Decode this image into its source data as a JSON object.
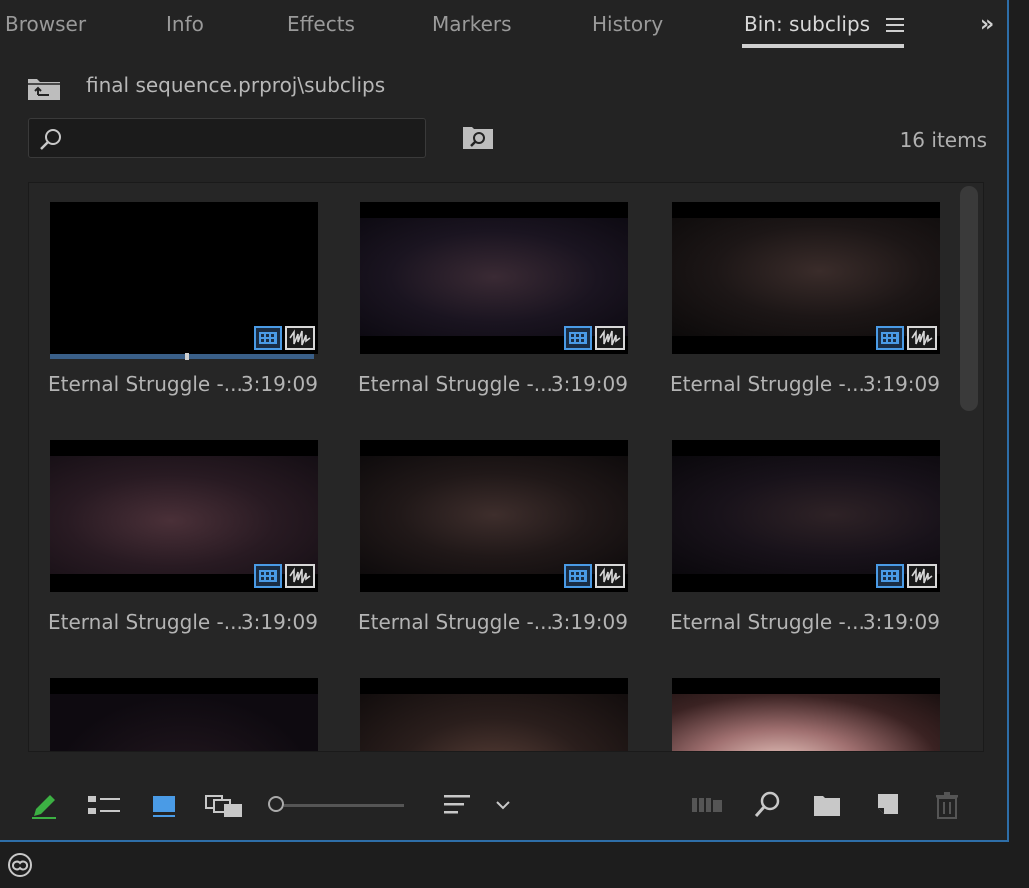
{
  "tabs": [
    {
      "label": "Browser"
    },
    {
      "label": "Info"
    },
    {
      "label": "Effects"
    },
    {
      "label": "Markers"
    },
    {
      "label": "History"
    },
    {
      "label": "Bin: subclips"
    }
  ],
  "active_tab": "Bin: subclips",
  "bin_path": "final sequence.prproj\\subclips",
  "search": {
    "value": "",
    "placeholder": ""
  },
  "item_count": "16 items",
  "clips": [
    {
      "name": "Eternal Struggle -...",
      "duration": "3:19:09",
      "playhead_fraction": 0.52
    },
    {
      "name": "Eternal Struggle -...",
      "duration": "3:19:09"
    },
    {
      "name": "Eternal Struggle -...",
      "duration": "3:19:09"
    },
    {
      "name": "Eternal Struggle -...",
      "duration": "3:19:09"
    },
    {
      "name": "Eternal Struggle -...",
      "duration": "3:19:09"
    },
    {
      "name": "Eternal Struggle -...",
      "duration": "3:19:09"
    }
  ],
  "colors": {
    "accent_blue": "#4a9be6",
    "panel_border": "#2e6ea8",
    "pencil_green": "#3cb043"
  },
  "toolbar_icons": [
    "pencil-icon",
    "list-view-icon",
    "icon-view-icon",
    "freeform-view-icon",
    "zoom-slider",
    "sort-icon",
    "automate-to-sequence-icon",
    "find-icon",
    "new-bin-icon",
    "new-item-icon",
    "trash-icon"
  ]
}
